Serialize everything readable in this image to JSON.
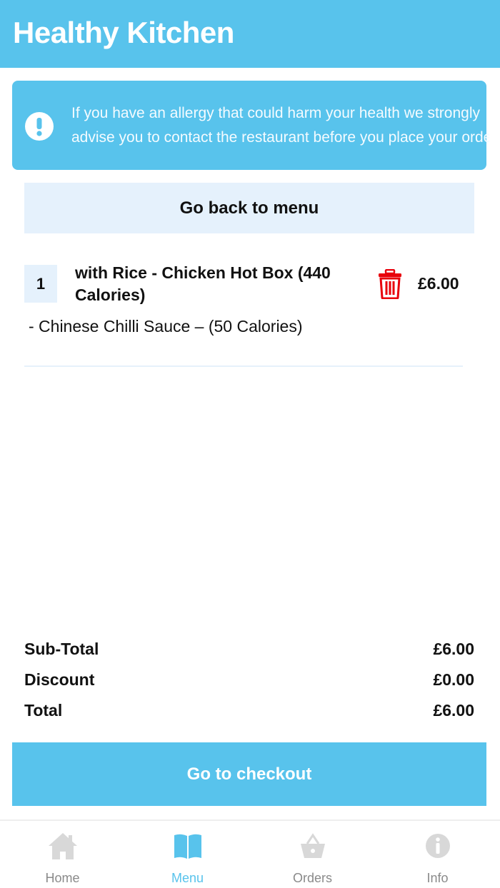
{
  "header": {
    "title": "Healthy Kitchen"
  },
  "allergy_notice": {
    "icon": "exclamation-circle-icon",
    "lines": [
      "If you have an allergy that could harm your health we strongly",
      "advise you to contact the restaurant before you place your order"
    ]
  },
  "back_button_label": "Go back to menu",
  "basket_item": {
    "quantity": "1",
    "name": "with Rice - Chicken Hot Box (440 Calories)",
    "price": "£6.00",
    "option": "- Chinese Chilli Sauce – (50 Calories)",
    "delete_icon": "trash-icon"
  },
  "totals": {
    "subtotal_label": "Sub-Total",
    "subtotal_value": "£6.00",
    "discount_label": "Discount",
    "discount_value": "£0.00",
    "total_label": "Total",
    "total_value": "£6.00"
  },
  "checkout_button_label": "Go to checkout",
  "nav": {
    "items": [
      {
        "label": "Home",
        "icon": "home-icon"
      },
      {
        "label": "Menu",
        "icon": "book-icon",
        "active": true
      },
      {
        "label": "Orders",
        "icon": "basket-icon"
      },
      {
        "label": "Info",
        "icon": "info-icon"
      }
    ]
  },
  "colors": {
    "brand": "#58c3ec",
    "light_panel": "#e5f1fc",
    "delete": "#e8000b",
    "nav_inactive": "#d8d8d8"
  }
}
